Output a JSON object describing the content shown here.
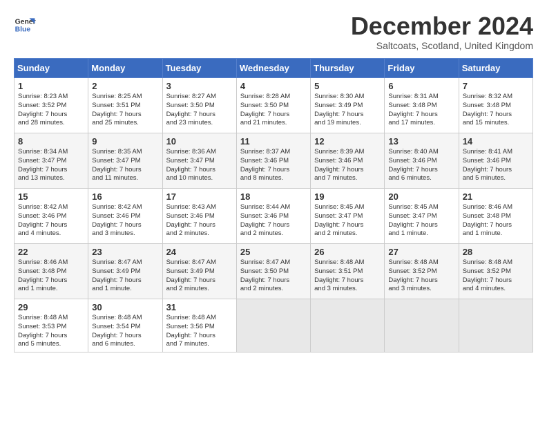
{
  "logo": {
    "line1": "General",
    "line2": "Blue"
  },
  "title": "December 2024",
  "location": "Saltcoats, Scotland, United Kingdom",
  "days_of_week": [
    "Sunday",
    "Monday",
    "Tuesday",
    "Wednesday",
    "Thursday",
    "Friday",
    "Saturday"
  ],
  "weeks": [
    [
      {
        "day": 1,
        "info": "Sunrise: 8:23 AM\nSunset: 3:52 PM\nDaylight: 7 hours\nand 28 minutes."
      },
      {
        "day": 2,
        "info": "Sunrise: 8:25 AM\nSunset: 3:51 PM\nDaylight: 7 hours\nand 25 minutes."
      },
      {
        "day": 3,
        "info": "Sunrise: 8:27 AM\nSunset: 3:50 PM\nDaylight: 7 hours\nand 23 minutes."
      },
      {
        "day": 4,
        "info": "Sunrise: 8:28 AM\nSunset: 3:50 PM\nDaylight: 7 hours\nand 21 minutes."
      },
      {
        "day": 5,
        "info": "Sunrise: 8:30 AM\nSunset: 3:49 PM\nDaylight: 7 hours\nand 19 minutes."
      },
      {
        "day": 6,
        "info": "Sunrise: 8:31 AM\nSunset: 3:48 PM\nDaylight: 7 hours\nand 17 minutes."
      },
      {
        "day": 7,
        "info": "Sunrise: 8:32 AM\nSunset: 3:48 PM\nDaylight: 7 hours\nand 15 minutes."
      }
    ],
    [
      {
        "day": 8,
        "info": "Sunrise: 8:34 AM\nSunset: 3:47 PM\nDaylight: 7 hours\nand 13 minutes."
      },
      {
        "day": 9,
        "info": "Sunrise: 8:35 AM\nSunset: 3:47 PM\nDaylight: 7 hours\nand 11 minutes."
      },
      {
        "day": 10,
        "info": "Sunrise: 8:36 AM\nSunset: 3:47 PM\nDaylight: 7 hours\nand 10 minutes."
      },
      {
        "day": 11,
        "info": "Sunrise: 8:37 AM\nSunset: 3:46 PM\nDaylight: 7 hours\nand 8 minutes."
      },
      {
        "day": 12,
        "info": "Sunrise: 8:39 AM\nSunset: 3:46 PM\nDaylight: 7 hours\nand 7 minutes."
      },
      {
        "day": 13,
        "info": "Sunrise: 8:40 AM\nSunset: 3:46 PM\nDaylight: 7 hours\nand 6 minutes."
      },
      {
        "day": 14,
        "info": "Sunrise: 8:41 AM\nSunset: 3:46 PM\nDaylight: 7 hours\nand 5 minutes."
      }
    ],
    [
      {
        "day": 15,
        "info": "Sunrise: 8:42 AM\nSunset: 3:46 PM\nDaylight: 7 hours\nand 4 minutes."
      },
      {
        "day": 16,
        "info": "Sunrise: 8:42 AM\nSunset: 3:46 PM\nDaylight: 7 hours\nand 3 minutes."
      },
      {
        "day": 17,
        "info": "Sunrise: 8:43 AM\nSunset: 3:46 PM\nDaylight: 7 hours\nand 2 minutes."
      },
      {
        "day": 18,
        "info": "Sunrise: 8:44 AM\nSunset: 3:46 PM\nDaylight: 7 hours\nand 2 minutes."
      },
      {
        "day": 19,
        "info": "Sunrise: 8:45 AM\nSunset: 3:47 PM\nDaylight: 7 hours\nand 2 minutes."
      },
      {
        "day": 20,
        "info": "Sunrise: 8:45 AM\nSunset: 3:47 PM\nDaylight: 7 hours\nand 1 minute."
      },
      {
        "day": 21,
        "info": "Sunrise: 8:46 AM\nSunset: 3:48 PM\nDaylight: 7 hours\nand 1 minute."
      }
    ],
    [
      {
        "day": 22,
        "info": "Sunrise: 8:46 AM\nSunset: 3:48 PM\nDaylight: 7 hours\nand 1 minute."
      },
      {
        "day": 23,
        "info": "Sunrise: 8:47 AM\nSunset: 3:49 PM\nDaylight: 7 hours\nand 1 minute."
      },
      {
        "day": 24,
        "info": "Sunrise: 8:47 AM\nSunset: 3:49 PM\nDaylight: 7 hours\nand 2 minutes."
      },
      {
        "day": 25,
        "info": "Sunrise: 8:47 AM\nSunset: 3:50 PM\nDaylight: 7 hours\nand 2 minutes."
      },
      {
        "day": 26,
        "info": "Sunrise: 8:48 AM\nSunset: 3:51 PM\nDaylight: 7 hours\nand 3 minutes."
      },
      {
        "day": 27,
        "info": "Sunrise: 8:48 AM\nSunset: 3:52 PM\nDaylight: 7 hours\nand 3 minutes."
      },
      {
        "day": 28,
        "info": "Sunrise: 8:48 AM\nSunset: 3:52 PM\nDaylight: 7 hours\nand 4 minutes."
      }
    ],
    [
      {
        "day": 29,
        "info": "Sunrise: 8:48 AM\nSunset: 3:53 PM\nDaylight: 7 hours\nand 5 minutes."
      },
      {
        "day": 30,
        "info": "Sunrise: 8:48 AM\nSunset: 3:54 PM\nDaylight: 7 hours\nand 6 minutes."
      },
      {
        "day": 31,
        "info": "Sunrise: 8:48 AM\nSunset: 3:56 PM\nDaylight: 7 hours\nand 7 minutes."
      },
      {
        "day": null,
        "info": ""
      },
      {
        "day": null,
        "info": ""
      },
      {
        "day": null,
        "info": ""
      },
      {
        "day": null,
        "info": ""
      }
    ]
  ]
}
